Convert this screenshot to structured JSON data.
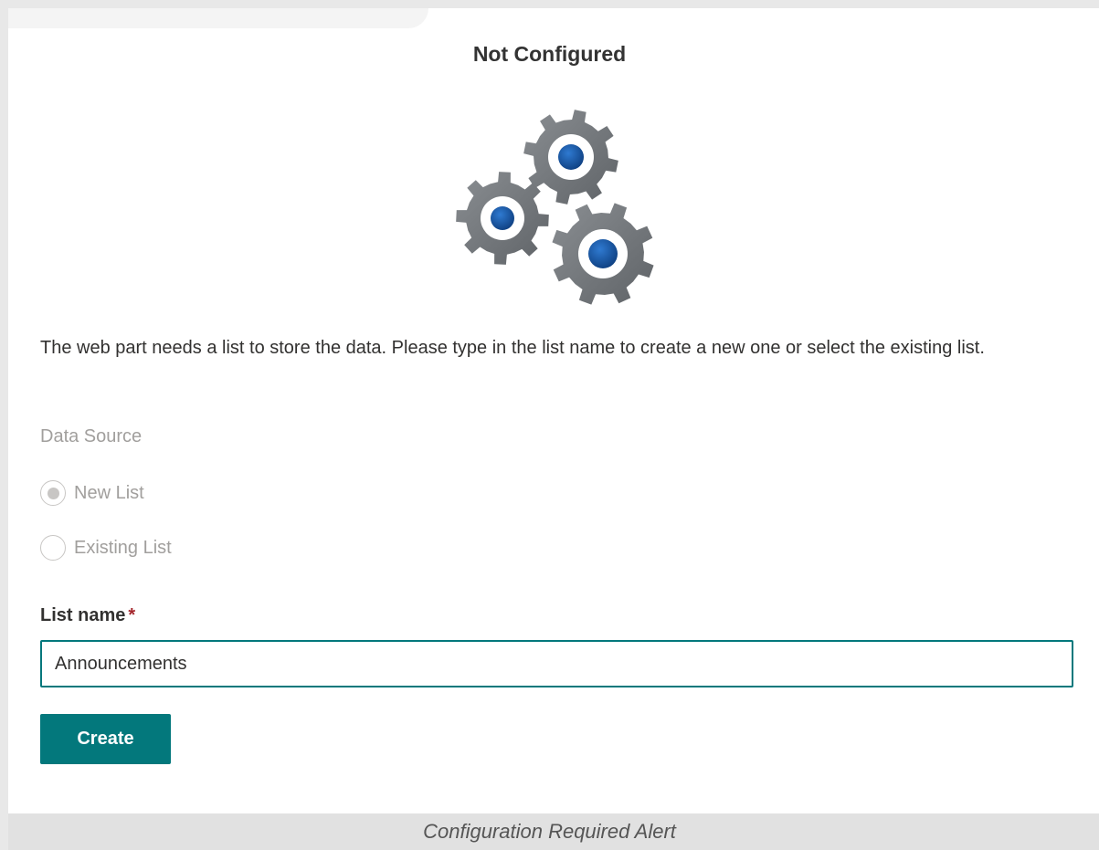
{
  "header": {
    "title": "Not Configured"
  },
  "illustration": {
    "icon": "gears-icon",
    "gear_color": "#767a7e",
    "hub_color": "#1857a4"
  },
  "form": {
    "description": "The web part needs a list to store the data. Please type in the list name to create a new one or select the existing list.",
    "data_source_label": "Data Source",
    "options": [
      {
        "label": "New List",
        "selected": true
      },
      {
        "label": "Existing List",
        "selected": false
      }
    ],
    "list_name_label": "List name",
    "required_marker": "*",
    "list_name_value": "Announcements",
    "create_label": "Create"
  },
  "caption": {
    "text": "Configuration Required Alert"
  },
  "colors": {
    "accent": "#03787c",
    "required": "#a4262c",
    "disabled_text": "#a19f9d"
  }
}
